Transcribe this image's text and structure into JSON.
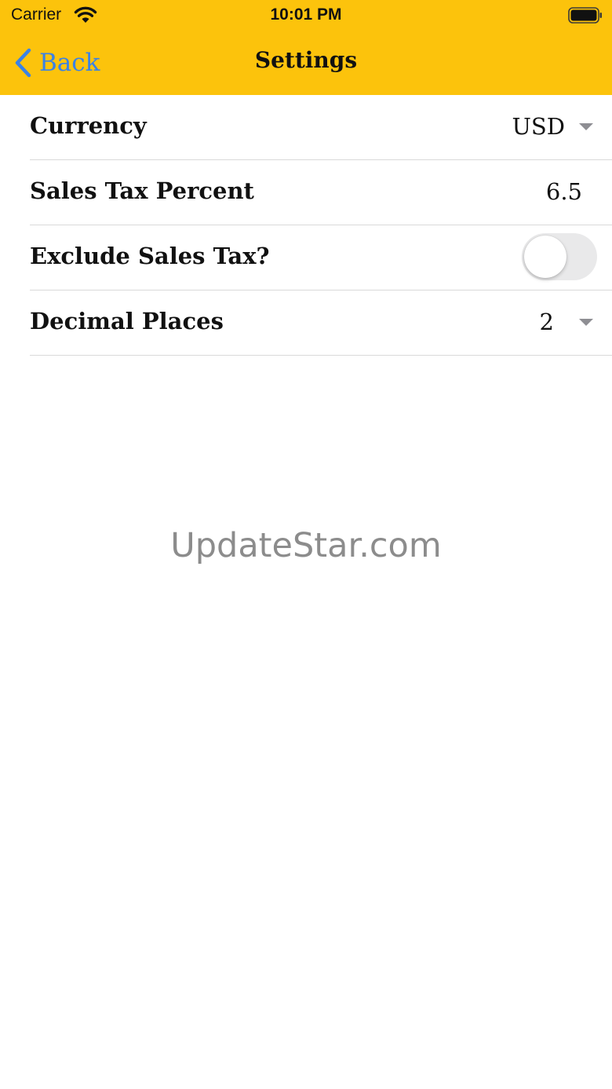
{
  "status_bar": {
    "carrier": "Carrier",
    "time": "10:01 PM"
  },
  "nav": {
    "back_label": "Back",
    "title": "Settings"
  },
  "settings": {
    "currency": {
      "label": "Currency",
      "value": "USD"
    },
    "sales_tax_percent": {
      "label": "Sales Tax Percent",
      "value": "6.5"
    },
    "exclude_sales_tax": {
      "label": "Exclude Sales Tax?",
      "on": false
    },
    "decimal_places": {
      "label": "Decimal Places",
      "value": "2"
    }
  },
  "watermark": "UpdateStar.com",
  "colors": {
    "header_bg": "#fcc30c",
    "back_link": "#3b82e5",
    "toggle_off": "#e9e9ea",
    "caret": "#8e8e93",
    "watermark": "#8c8c8c"
  },
  "icons": {
    "wifi": "wifi-icon",
    "battery": "battery-icon",
    "back": "chevron-left-icon",
    "dropdown": "caret-down-icon"
  }
}
